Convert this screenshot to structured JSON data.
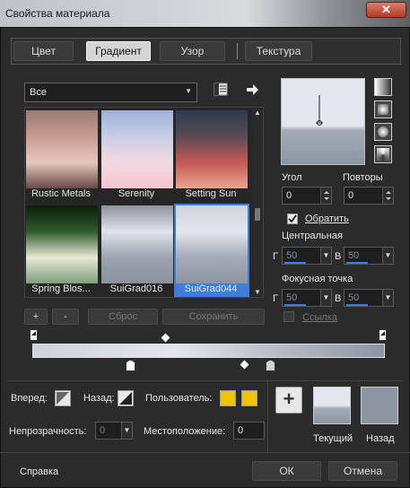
{
  "window": {
    "title": "Свойства материала",
    "close_glyph": "✕"
  },
  "tabs": [
    {
      "label": "Цвет"
    },
    {
      "label": "Градиент"
    },
    {
      "label": "Узор"
    },
    {
      "label": "Текстура"
    }
  ],
  "library": {
    "category": "Все",
    "presets": [
      {
        "name": "Rustic Metals",
        "gradient": [
          "#9a7a72",
          "#c79b8f",
          "#e4c8bf",
          "#6b4a44"
        ]
      },
      {
        "name": "Serenity",
        "gradient": [
          "#9db0d8",
          "#c7cde6",
          "#f3d9e0",
          "#f7c6cf"
        ]
      },
      {
        "name": "Setting Sun",
        "gradient": [
          "#2b3b4f",
          "#5b4a55",
          "#c45a55",
          "#e9a491"
        ]
      },
      {
        "name": "Spring Blos...",
        "gradient": [
          "#0b1f0b",
          "#2f5a2c",
          "#e8e8d5",
          "#7fa07a"
        ]
      },
      {
        "name": "SuiGrad016",
        "gradient": [
          "#8c929e",
          "#dfe3ea",
          "#9ca3af",
          "#8b919c"
        ]
      },
      {
        "name": "SuiGrad044",
        "gradient": [
          "#ced2da",
          "#e3e6ec",
          "#a4abb7",
          "#8d95a3"
        ]
      }
    ],
    "selected": "SuiGrad044"
  },
  "preset_buttons": {
    "add": "+",
    "remove": "-",
    "reset": "Сброс",
    "save": "Сохранить"
  },
  "settings": {
    "angle_label": "Угол",
    "angle_value": "0",
    "repeats_label": "Повторы",
    "repeats_value": "0",
    "invert_label": "Обратить",
    "invert_checked": true,
    "center_label": "Центральная",
    "center_h_prefix": "Г",
    "center_h": "50",
    "center_v_prefix": "В",
    "center_v": "50",
    "focal_label": "Фокусная точка",
    "focal_h_prefix": "Г",
    "focal_h": "50",
    "focal_v_prefix": "В",
    "focal_v": "50",
    "link_label": "Ссылка",
    "link_checked": false
  },
  "stops": {
    "forward_label": "Вперед:",
    "back_label": "Назад:",
    "user_label": "Пользователь:",
    "opacity_label": "Непрозрачность:",
    "opacity_value": "0",
    "location_label": "Местоположение:",
    "location_value": "0"
  },
  "swatches": {
    "add": "+",
    "current_label": "Текущий",
    "back_label": "Назад"
  },
  "colors": {
    "user1": "#f2c200",
    "user2": "#f2c200",
    "accent": "#3d7fd6"
  },
  "footer": {
    "help": "Справка",
    "ok": "ОК",
    "cancel": "Отмена"
  }
}
